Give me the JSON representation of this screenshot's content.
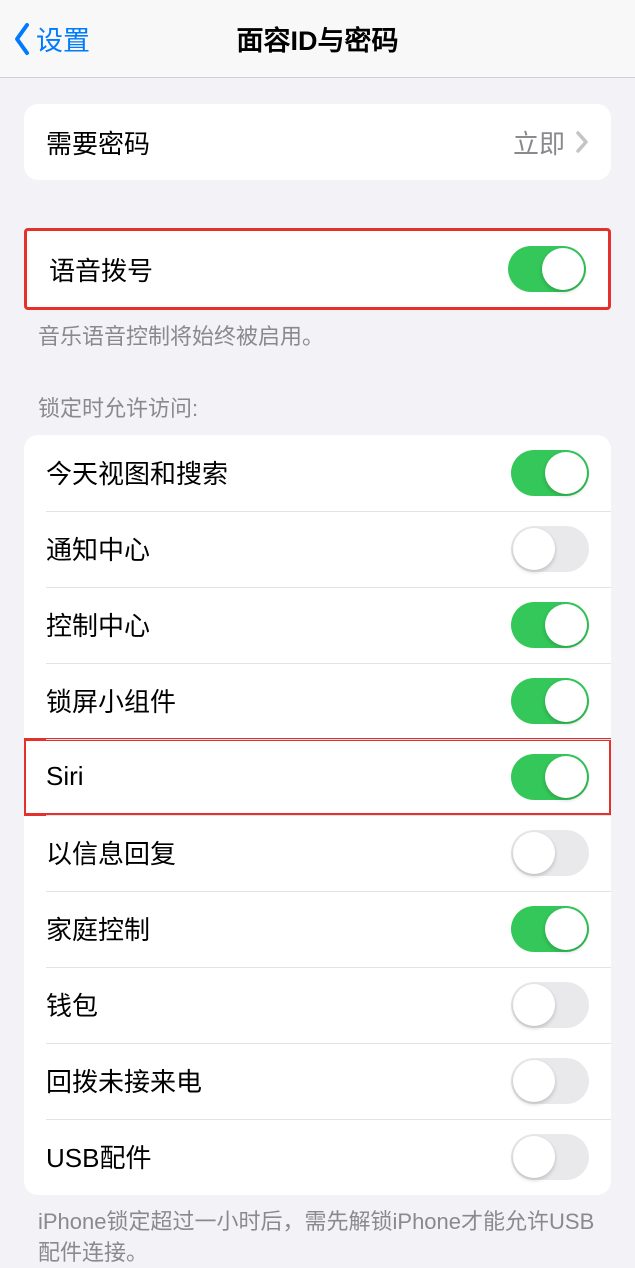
{
  "nav": {
    "back_label": "设置",
    "title": "面容ID与密码"
  },
  "passcode_section": {
    "require_passcode": {
      "label": "需要密码",
      "value": "立即"
    }
  },
  "voice_dial": {
    "label": "语音拨号",
    "on": true,
    "footer": "音乐语音控制将始终被启用。"
  },
  "lock_access": {
    "header": "锁定时允许访问:",
    "items": [
      {
        "label": "今天视图和搜索",
        "on": true,
        "highlighted": false
      },
      {
        "label": "通知中心",
        "on": false,
        "highlighted": false
      },
      {
        "label": "控制中心",
        "on": true,
        "highlighted": false
      },
      {
        "label": "锁屏小组件",
        "on": true,
        "highlighted": false
      },
      {
        "label": "Siri",
        "on": true,
        "highlighted": true
      },
      {
        "label": "以信息回复",
        "on": false,
        "highlighted": false
      },
      {
        "label": "家庭控制",
        "on": true,
        "highlighted": false
      },
      {
        "label": "钱包",
        "on": false,
        "highlighted": false
      },
      {
        "label": "回拨未接来电",
        "on": false,
        "highlighted": false
      },
      {
        "label": "USB配件",
        "on": false,
        "highlighted": false
      }
    ],
    "footer": "iPhone锁定超过一小时后，需先解锁iPhone才能允许USB配件连接。"
  }
}
